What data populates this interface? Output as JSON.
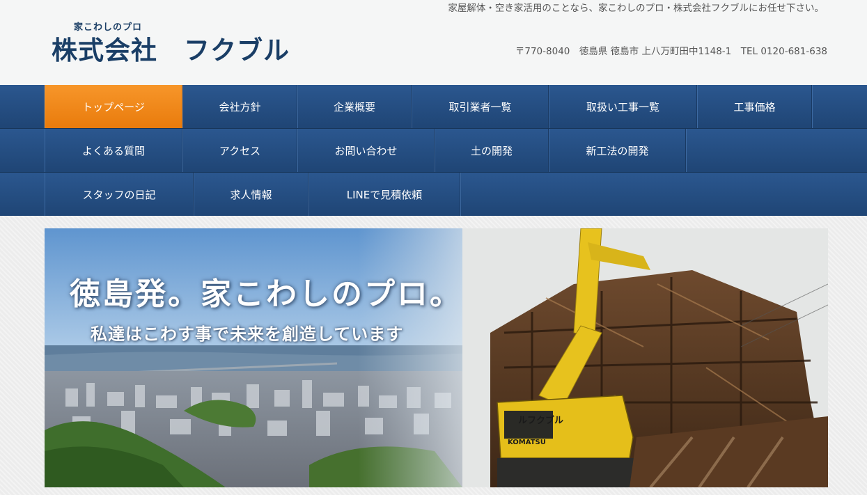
{
  "header": {
    "tagline": "家屋解体・空き家活用のことなら、家こわしのプロ・株式会社フクブルにお任せ下さい。",
    "logo_sub": "家こわしのプロ",
    "logo_main": "株式会社　フクブル",
    "address": "〒770-8040　徳島県 徳島市 上八万町田中1148-1　TEL 0120-681-638"
  },
  "nav": {
    "row1": [
      "トップページ",
      "会社方針",
      "企業概要",
      "取引業者一覧",
      "取扱い工事一覧",
      "工事価格"
    ],
    "row2": [
      "よくある質問",
      "アクセス",
      "お問い合わせ",
      "土の開発",
      "新工法の開発"
    ],
    "row3": [
      "スタッフの日記",
      "求人情報",
      "LINEで見積依頼"
    ],
    "active": "トップページ"
  },
  "hero": {
    "title": "徳島発。家こわしのプロ。",
    "subtitle": "私達はこわす事で未来を創造しています",
    "excavator_text": "ルフクブル",
    "excavator_brand": "KOMATSU"
  },
  "colors": {
    "nav_bg": "#234a7c",
    "nav_active": "#f0860f",
    "logo": "#1a3e66"
  }
}
